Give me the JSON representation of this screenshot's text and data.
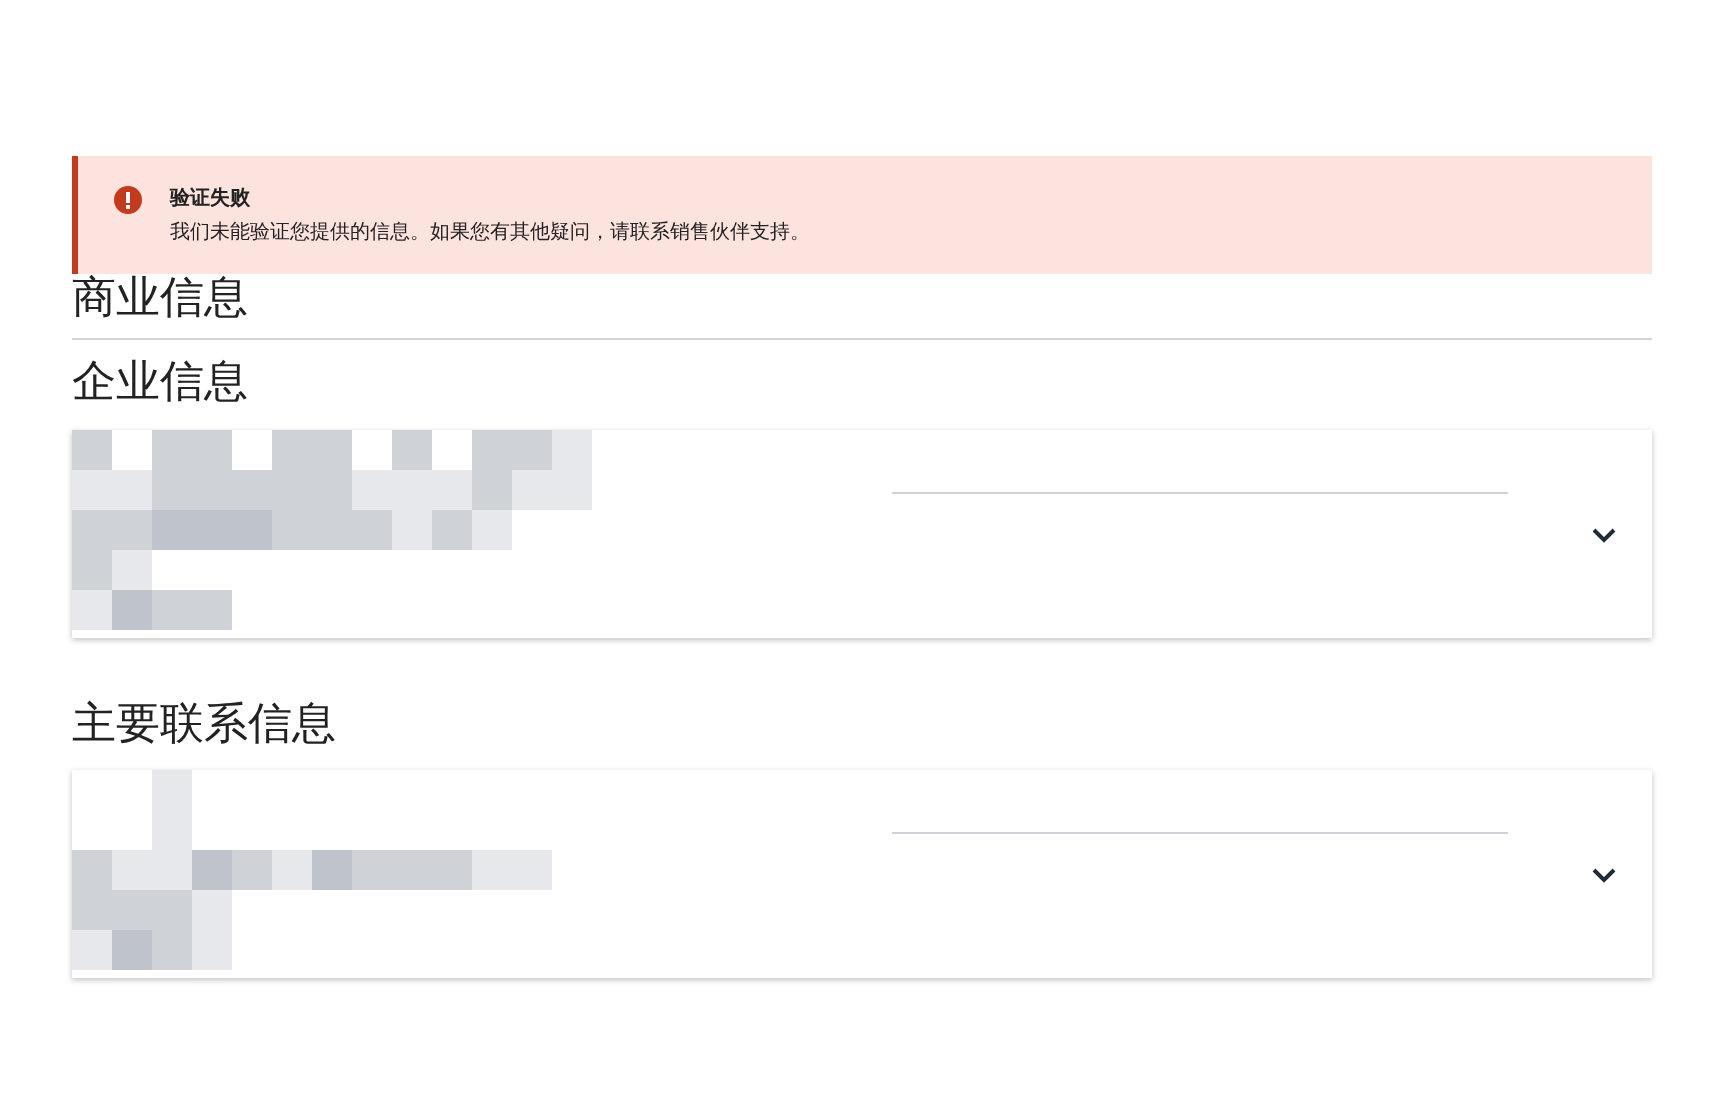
{
  "alert": {
    "kind": "error",
    "title": "验证失败",
    "message": "我们未能验证您提供的信息。如果您有其他疑问，请联系销售伙伴支持。"
  },
  "page_title": "商业信息",
  "sections": [
    {
      "title": "企业信息",
      "card": {
        "expanded": false
      }
    },
    {
      "title": "主要联系信息",
      "card": {
        "expanded": false
      }
    }
  ]
}
